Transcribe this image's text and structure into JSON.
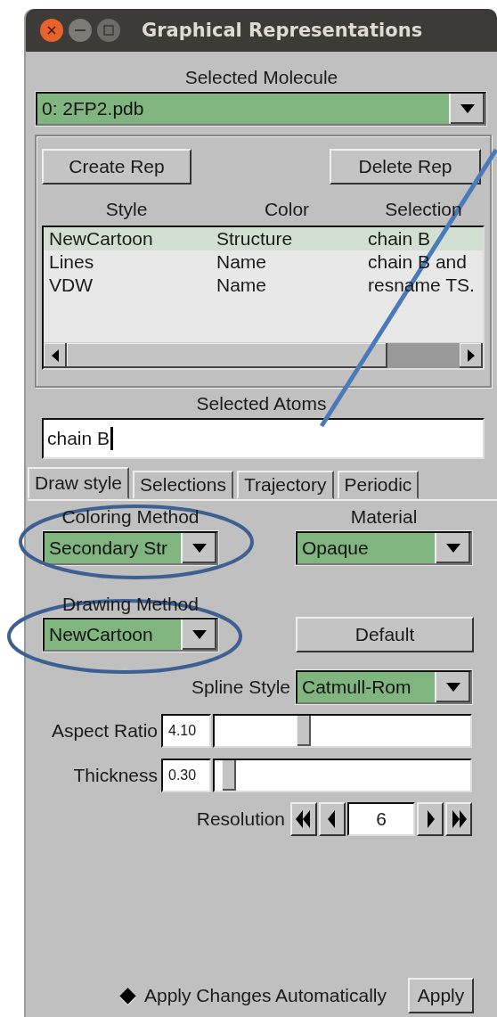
{
  "window": {
    "title": "Graphical Representations"
  },
  "selected_molecule": {
    "label": "Selected Molecule",
    "value": "0: 2FP2.pdb"
  },
  "rep_buttons": [
    "Create Rep",
    "Delete Rep"
  ],
  "reps": {
    "columns": [
      "Style",
      "Color",
      "Selection"
    ],
    "rows": [
      {
        "cells": [
          "NewCartoon",
          "Structure",
          "chain B"
        ],
        "selected": true
      },
      {
        "cells": [
          "Lines",
          "Name",
          "chain B and"
        ],
        "selected": false
      },
      {
        "cells": [
          "VDW",
          "Name",
          "resname TS."
        ],
        "selected": false
      }
    ]
  },
  "selected_atoms": {
    "label": "Selected Atoms",
    "value": "chain B"
  },
  "tabs": [
    {
      "label": "Draw style",
      "selected": true
    },
    {
      "label": "Selections",
      "selected": false
    },
    {
      "label": "Trajectory",
      "selected": false
    },
    {
      "label": "Periodic",
      "selected": false
    }
  ],
  "coloring_method": {
    "label": "Coloring Method",
    "value": "Secondary Str"
  },
  "material": {
    "label": "Material",
    "value": "Opaque"
  },
  "drawing_method": {
    "label": "Drawing Method",
    "value": "NewCartoon"
  },
  "default_button": "Default",
  "spline_style": {
    "label": "Spline Style",
    "value": "Catmull-Rom"
  },
  "sliders": [
    {
      "label": "Aspect Ratio",
      "reading": "4.10",
      "level": 0.34
    },
    {
      "label": "Thickness",
      "reading": "0.30",
      "level": 0.03
    }
  ],
  "resolution": {
    "label": "Resolution",
    "value": "6"
  },
  "apply_automatically": {
    "label": "Apply Changes Automatically",
    "checked": true
  },
  "apply_button": "Apply"
}
